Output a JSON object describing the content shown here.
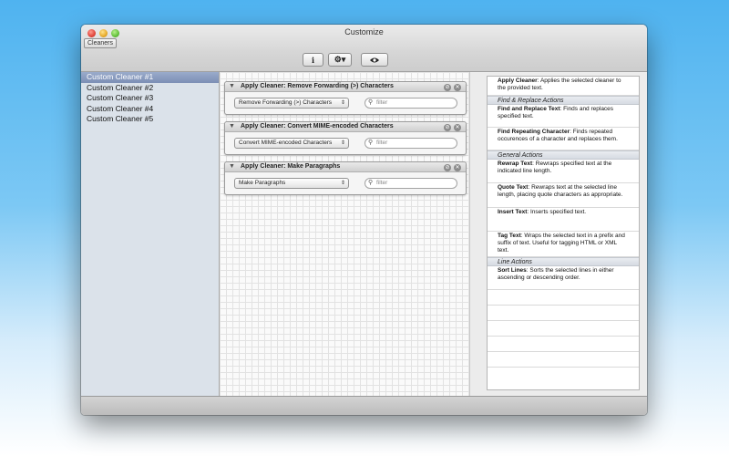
{
  "window": {
    "title": "Customize",
    "tab_label": "Cleaners"
  },
  "toolbar": {
    "info_icon": "info-icon",
    "gear_icon": "gear-menu-icon",
    "eye_icon": "eye-icon"
  },
  "sidebar": {
    "items": [
      {
        "label": "Custom Cleaner #1",
        "selected": true
      },
      {
        "label": "Custom Cleaner #2",
        "selected": false
      },
      {
        "label": "Custom Cleaner #3",
        "selected": false
      },
      {
        "label": "Custom Cleaner #4",
        "selected": false
      },
      {
        "label": "Custom Cleaner #5",
        "selected": false
      }
    ]
  },
  "actions": [
    {
      "title": "Apply Cleaner: Remove Forwarding (>) Characters",
      "selected_value": "Remove Forwarding (>) Characters",
      "filter_placeholder": "filter"
    },
    {
      "title": "Apply Cleaner: Convert MIME-encoded Characters",
      "selected_value": "Convert MIME-encoded Characters",
      "filter_placeholder": "filter"
    },
    {
      "title": "Apply Cleaner: Make Paragraphs",
      "selected_value": "Make Paragraphs",
      "filter_placeholder": "filter"
    }
  ],
  "help": {
    "apply_cleaner": {
      "name": "Apply Cleaner",
      "desc": ": Applies the selected cleaner to the provided text."
    },
    "section_find_replace": "Find & Replace Actions",
    "find_replace_text": {
      "name": "Find and Replace Text",
      "desc": ": Finds and replaces specified text."
    },
    "find_repeating": {
      "name": "Find Repeating Character",
      "desc": ": Finds repeated occurences of a character and replaces them."
    },
    "section_general": "General Actions",
    "rewrap_text": {
      "name": "Rewrap Text",
      "desc": ": Rewraps specified text at the indicated line length."
    },
    "quote_text": {
      "name": "Quote Text",
      "desc": ": Rewraps text at the selected line length, placing quote characters as appropriate."
    },
    "insert_text": {
      "name": "Insert Text",
      "desc": ": Inserts specified text."
    },
    "tag_text": {
      "name": "Tag Text",
      "desc": ": Wraps the selected text in a prefix and suffix of text. Useful for tagging HTML or XML text."
    },
    "section_line": "Line Actions",
    "sort_lines": {
      "name": "Sort Lines",
      "desc": ": Sorts the selected lines in either ascending or descending order."
    }
  }
}
